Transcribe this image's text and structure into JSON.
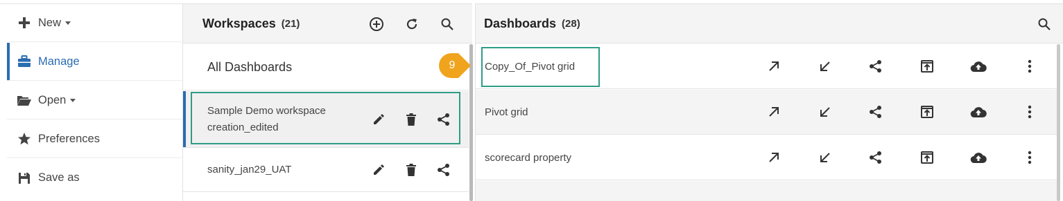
{
  "menu": {
    "items": [
      {
        "label": "New",
        "icon": "plus-icon"
      },
      {
        "label": "Manage",
        "icon": "briefcase-icon"
      },
      {
        "label": "Open",
        "icon": "folder-open-icon"
      },
      {
        "label": "Preferences",
        "icon": "star-icon"
      },
      {
        "label": "Save as",
        "icon": "floppy-icon"
      }
    ]
  },
  "workspaces": {
    "title": "Workspaces",
    "count": "(21)",
    "all_label": "All Dashboards",
    "items": [
      {
        "name": "Sample Demo workspace creation_edited"
      },
      {
        "name": "sanity_jan29_UAT"
      }
    ]
  },
  "dashboards": {
    "title": "Dashboards",
    "count": "(28)",
    "items": [
      {
        "name": "Copy_Of_Pivot grid"
      },
      {
        "name": "Pivot grid"
      },
      {
        "name": "scorecard property"
      }
    ]
  },
  "annotation": {
    "badge": "9"
  },
  "colors": {
    "accent": "#2b6cb0",
    "highlight": "#2e9c86",
    "badge": "#f0a31c"
  }
}
